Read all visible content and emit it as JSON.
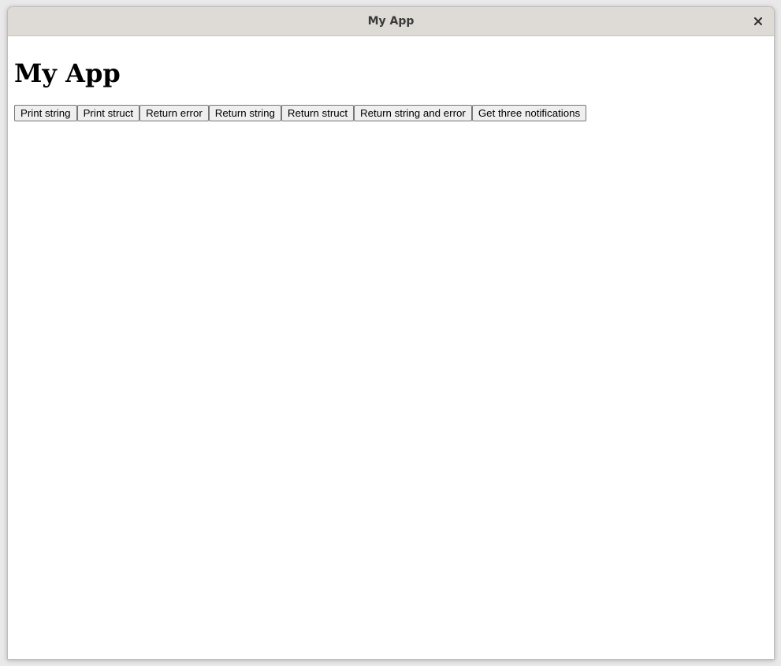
{
  "window": {
    "title": "My App",
    "close_icon": "close-icon"
  },
  "main": {
    "heading": "My App",
    "buttons": [
      {
        "label": "Print string"
      },
      {
        "label": "Print struct"
      },
      {
        "label": "Return error"
      },
      {
        "label": "Return string"
      },
      {
        "label": "Return struct"
      },
      {
        "label": "Return string and error"
      },
      {
        "label": "Get three notifications"
      }
    ]
  }
}
